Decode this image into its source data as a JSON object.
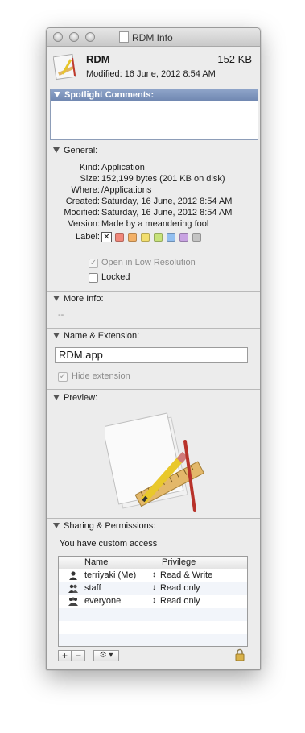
{
  "window": {
    "title": "RDM Info"
  },
  "header": {
    "name": "RDM",
    "size": "152 KB",
    "modified": "Modified: 16 June, 2012 8:54 AM",
    "icon": "app-document-icon"
  },
  "spotlight": {
    "title": "Spotlight Comments:",
    "value": ""
  },
  "general": {
    "title": "General:",
    "rows": [
      {
        "key": "Kind:",
        "value": "Application"
      },
      {
        "key": "Size:",
        "value": "152,199 bytes (201 KB on disk)"
      },
      {
        "key": "Where:",
        "value": "/Applications"
      },
      {
        "key": "Created:",
        "value": "Saturday, 16 June, 2012 8:54 AM"
      },
      {
        "key": "Modified:",
        "value": "Saturday, 16 June, 2012 8:54 AM"
      },
      {
        "key": "Version:",
        "value": "Made by a meandering fool"
      }
    ],
    "label_key": "Label:",
    "label_none": "✕",
    "label_colors": [
      "#f0877a",
      "#f3b167",
      "#f2de6e",
      "#c7e27a",
      "#92bff0",
      "#c8a3e2",
      "#c4c4c4"
    ],
    "low_res": "Open in Low Resolution",
    "low_res_checked": true,
    "locked": "Locked",
    "locked_checked": false
  },
  "more_info": {
    "title": "More Info:",
    "value": "--"
  },
  "name_ext": {
    "title": "Name & Extension:",
    "value": "RDM.app",
    "hide_ext": "Hide extension",
    "hide_ext_checked": true
  },
  "preview": {
    "title": "Preview:"
  },
  "sharing": {
    "title": "Sharing & Permissions:",
    "access": "You have custom access",
    "col_name": "Name",
    "col_priv": "Privilege",
    "rows": [
      {
        "name": "terriyaki (Me)",
        "priv": "Read & Write",
        "icon": "user-icon"
      },
      {
        "name": "staff",
        "priv": "Read only",
        "icon": "group-icon"
      },
      {
        "name": "everyone",
        "priv": "Read only",
        "icon": "everyone-icon"
      }
    ],
    "add": "+",
    "remove": "−",
    "action": "⚙ ▾"
  }
}
